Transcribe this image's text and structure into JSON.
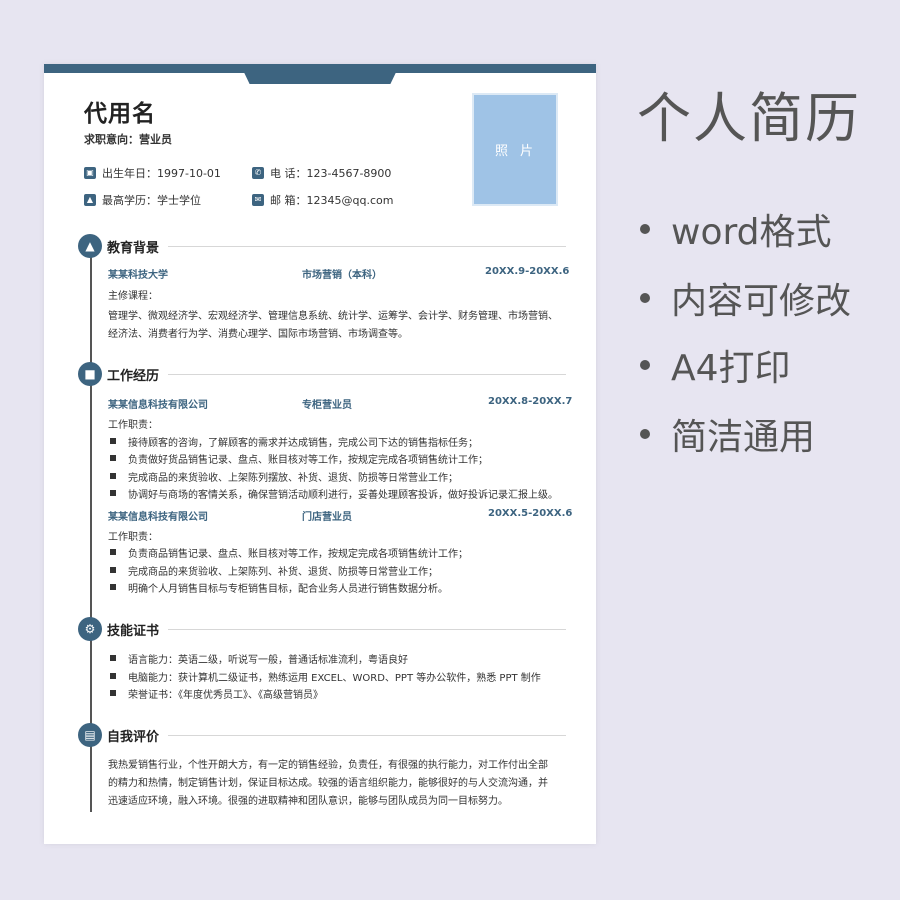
{
  "resume": {
    "name": "代用名",
    "intent": "求职意向：营业员",
    "info": {
      "birth": "出生年日：1997-10-01",
      "phone": "电  话：123-4567-8900",
      "degree": "最高学历：学士学位",
      "email": "邮  箱：12345@qq.com"
    },
    "photo_label": "照片",
    "sections": {
      "education": {
        "title": "教育背景",
        "school": "某某科技大学",
        "major": "市场营销（本科）",
        "period": "20XX.9-20XX.6",
        "courses_label": "主修课程：",
        "courses_line1": "管理学、微观经济学、宏观经济学、管理信息系统、统计学、运筹学、会计学、财务管理、市场营销、",
        "courses_line2": "经济法、消费者行为学、消费心理学、国际市场营销、市场调查等。"
      },
      "work": {
        "title": "工作经历",
        "jobs": [
          {
            "company": "某某信息科技有限公司",
            "position": "专柜营业员",
            "period": "20XX.8-20XX.7",
            "duty_label": "工作职责：",
            "duties": [
              "接待顾客的咨询，了解顾客的需求并达成销售，完成公司下达的销售指标任务；",
              "负责做好货品销售记录、盘点、账目核对等工作，按规定完成各项销售统计工作；",
              "完成商品的来货验收、上架陈列摆放、补货、退货、防损等日常营业工作；",
              "协调好与商场的客情关系，确保营销活动顺利进行，妥善处理顾客投诉，做好投诉记录汇报上级。"
            ]
          },
          {
            "company": "某某信息科技有限公司",
            "position": "门店营业员",
            "period": "20XX.5-20XX.6",
            "duty_label": "工作职责：",
            "duties": [
              "负责商品销售记录、盘点、账目核对等工作，按规定完成各项销售统计工作；",
              "完成商品的来货验收、上架陈列、补货、退货、防损等日常营业工作；",
              "明确个人月销售目标与专柜销售目标，配合业务人员进行销售数据分析。"
            ]
          }
        ]
      },
      "skills": {
        "title": "技能证书",
        "items": [
          "语言能力：英语二级，听说写一般，普通话标准流利，粤语良好",
          "电脑能力：获计算机二级证书，熟练运用 EXCEL、WORD、PPT 等办公软件，熟悉 PPT 制作",
          "荣誉证书：《年度优秀员工》、《高级营销员》"
        ]
      },
      "self": {
        "title": "自我评价",
        "line1": "我热爱销售行业，个性开朗大方，有一定的销售经验，负责任，有很强的执行能力，对工作付出全部",
        "line2": "的精力和热情，制定销售计划，保证目标达成。较强的语言组织能力，能够很好的与人交流沟通，并",
        "line3": "迅速适应环境，融入环境。很强的进取精神和团队意识，能够与团队成员为同一目标努力。"
      }
    }
  },
  "promo": {
    "title": "个人简历",
    "features": [
      "word格式",
      "内容可修改",
      "A4打印",
      "简洁通用"
    ]
  },
  "colors": {
    "accent": "#3d6480",
    "photo": "#9fc3e6",
    "background": "#e7e5f1",
    "promo_text": "#555555"
  },
  "icons": [
    "calendar-icon",
    "phone-icon",
    "graduation-icon",
    "mail-icon",
    "graduation-cap-icon",
    "briefcase-icon",
    "gear-icon",
    "notebook-icon"
  ]
}
